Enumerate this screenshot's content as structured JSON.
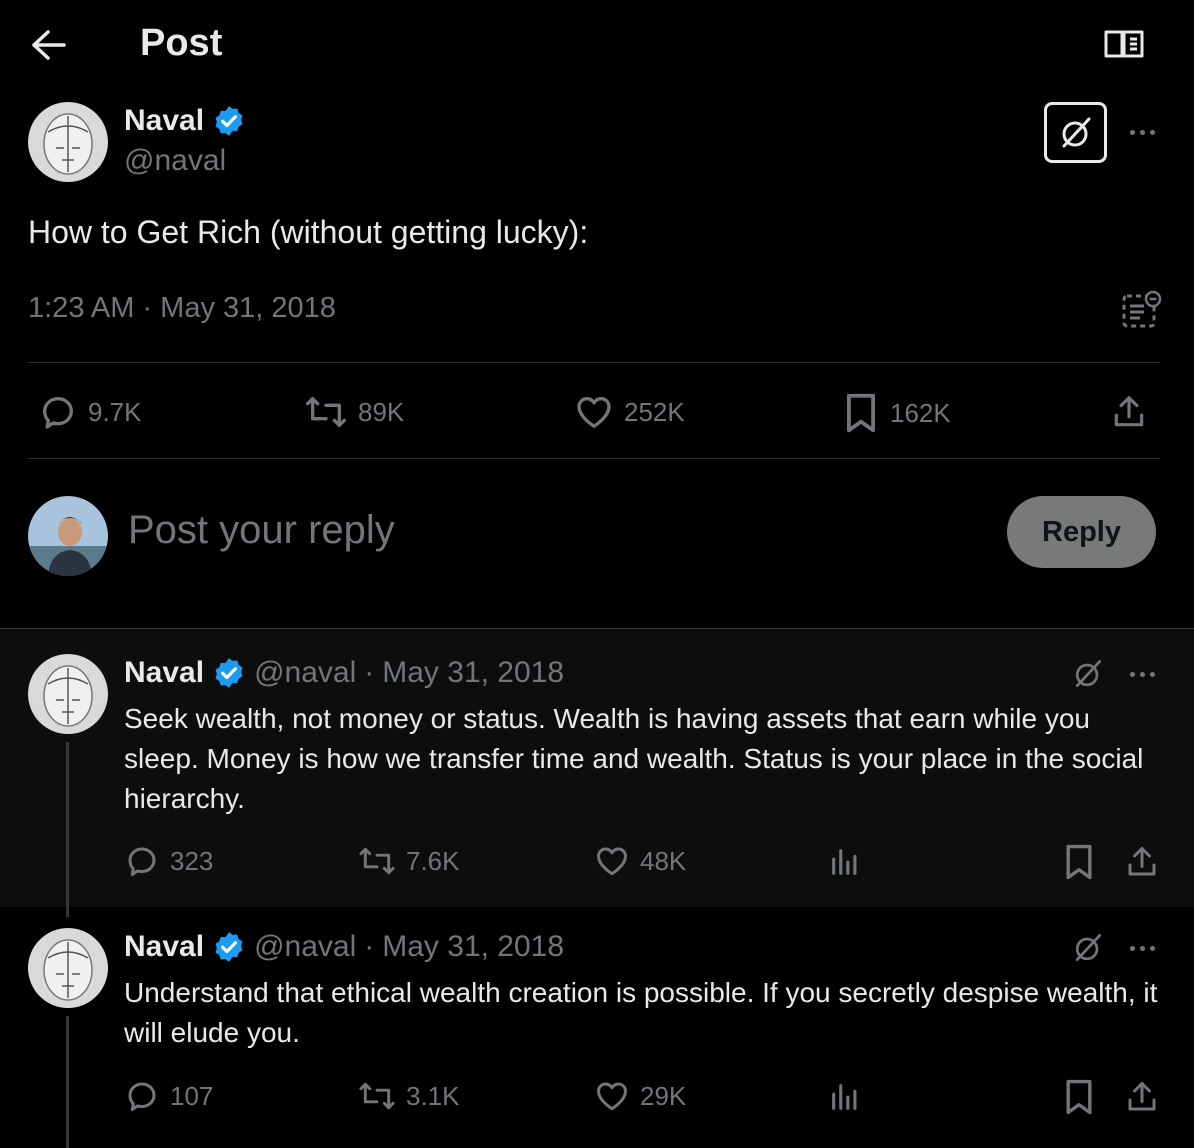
{
  "header": {
    "title": "Post"
  },
  "main_tweet": {
    "author_name": "Naval",
    "author_handle": "@naval",
    "text": "How to Get Rich (without getting lucky):",
    "timestamp": "1:23 AM · May 31, 2018",
    "stats": {
      "replies": "9.7K",
      "reposts": "89K",
      "likes": "252K",
      "bookmarks": "162K"
    }
  },
  "composer": {
    "placeholder": "Post your reply",
    "button_label": "Reply"
  },
  "replies": [
    {
      "author_name": "Naval",
      "author_handle": "@naval",
      "date": "May 31, 2018",
      "text": "Seek wealth, not money or status. Wealth is having assets that earn while you sleep. Money is how we transfer time and wealth. Status is your place in the social hierarchy.",
      "stats": {
        "replies": "323",
        "reposts": "7.6K",
        "likes": "48K"
      }
    },
    {
      "author_name": "Naval",
      "author_handle": "@naval",
      "date": "May 31, 2018",
      "text": "Understand that ethical wealth creation is possible. If you secretly despise wealth, it will elude you.",
      "stats": {
        "replies": "107",
        "reposts": "3.1K",
        "likes": "29K"
      }
    }
  ],
  "colors": {
    "background": "#000000",
    "text": "#e7e9ea",
    "muted": "#71767b",
    "verified": "#1d9bf0",
    "divider": "#2f3336"
  },
  "icons": [
    "back-arrow-icon",
    "reader-mode-icon",
    "verified-icon",
    "grok-icon",
    "more-icon",
    "analytics-icon",
    "reply-icon",
    "repost-icon",
    "like-icon",
    "bookmark-icon",
    "share-icon",
    "views-icon"
  ]
}
